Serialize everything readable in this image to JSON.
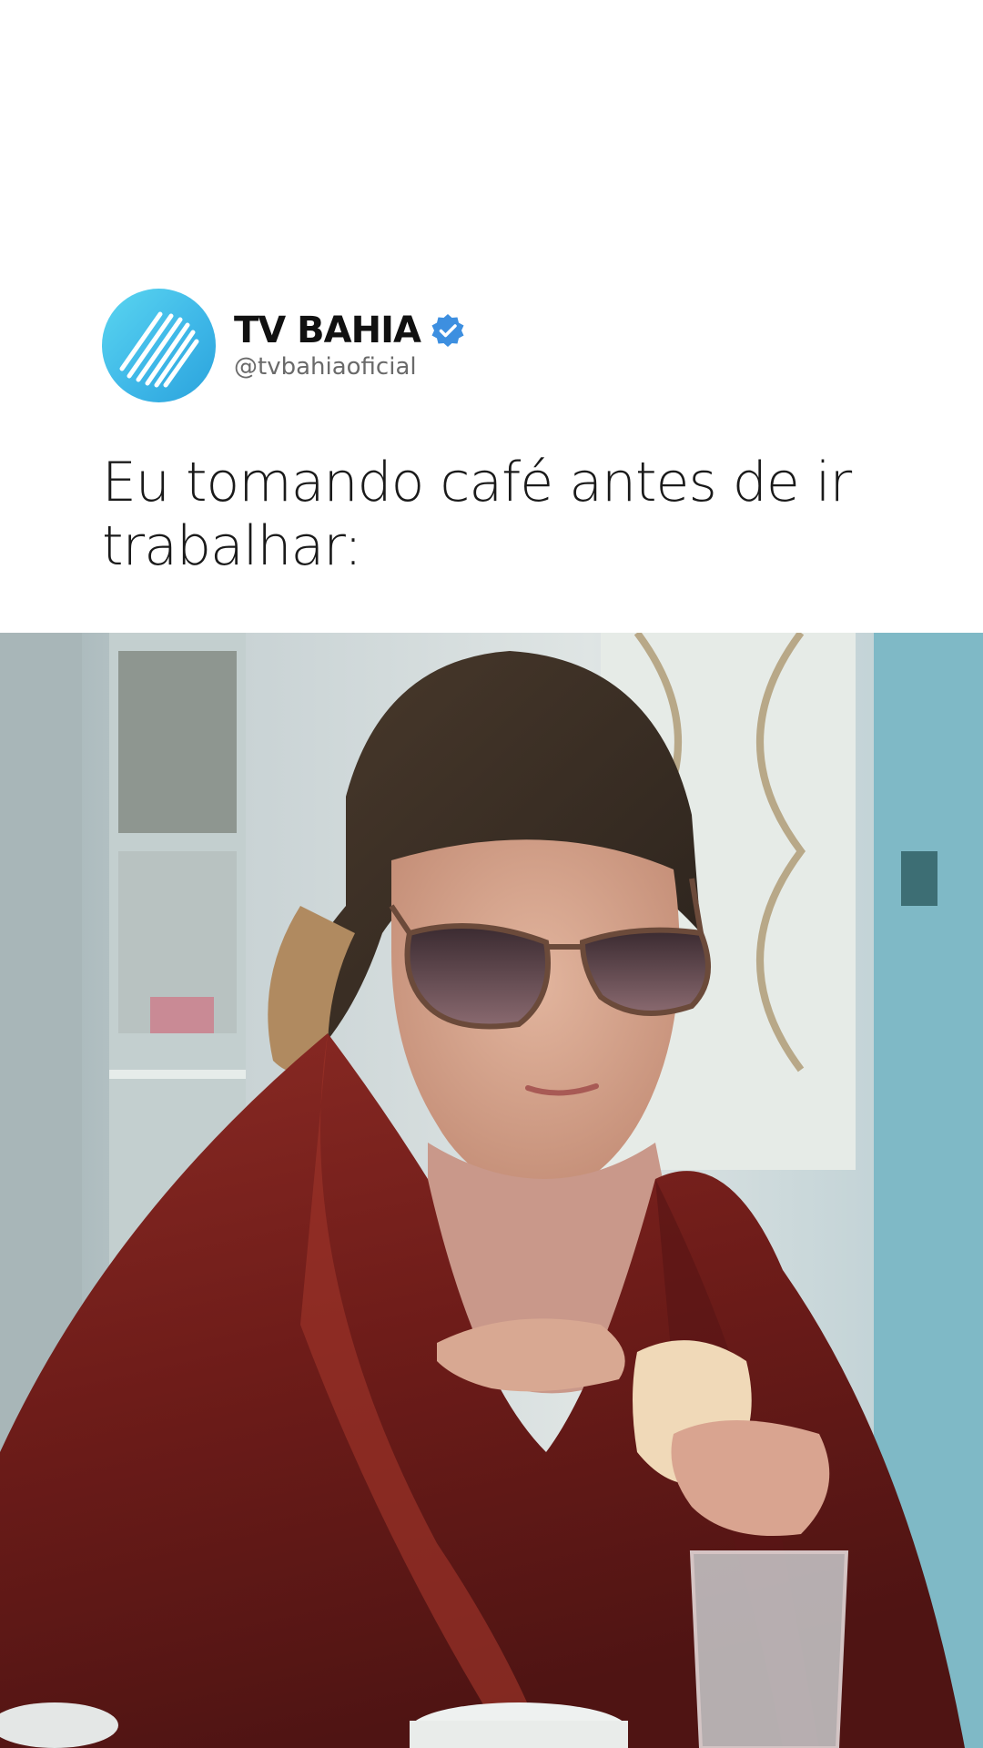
{
  "post": {
    "account_name": "TV BAHIA",
    "handle": "@tvbahiaoficial",
    "caption": "Eu tomando café antes de ir trabalhar:",
    "verified": true
  },
  "icons": {
    "avatar": "tv-bahia-logo-icon",
    "verified": "verified-badge-icon"
  },
  "colors": {
    "avatar_brand": "#3fb8e8",
    "verified_badge": "#3d8fe0",
    "caption_text": "#1a1a1a",
    "handle_text": "#6a6a6a"
  }
}
